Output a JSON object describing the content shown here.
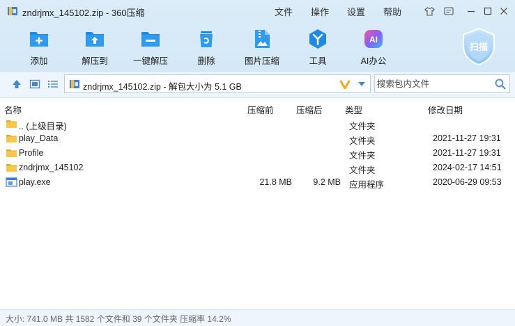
{
  "window": {
    "title": "zndrjmx_145102.zip - 360压缩"
  },
  "menu": [
    "文件",
    "操作",
    "设置",
    "帮助"
  ],
  "toolbar": [
    {
      "label": "添加",
      "icon": "add-icon"
    },
    {
      "label": "解压到",
      "icon": "extract-to-icon"
    },
    {
      "label": "一键解压",
      "icon": "one-click-extract-icon"
    },
    {
      "label": "删除",
      "icon": "delete-icon"
    },
    {
      "label": "图片压缩",
      "icon": "image-compress-icon"
    },
    {
      "label": "工具",
      "icon": "tools-icon"
    },
    {
      "label": "AI办公",
      "icon": "ai-office-icon"
    }
  ],
  "scan": {
    "label": "扫描"
  },
  "address": {
    "path": "zndrjmx_145102.zip - 解包大小为 5.1 GB"
  },
  "search": {
    "placeholder": "搜索包内文件"
  },
  "columns": {
    "name": "名称",
    "before": "压缩前",
    "after": "压缩后",
    "type": "类型",
    "date": "修改日期"
  },
  "files": [
    {
      "name": ".. (上级目录)",
      "before": "",
      "after": "",
      "type": "文件夹",
      "date": "",
      "icon": "folder-icon"
    },
    {
      "name": "play_Data",
      "before": "",
      "after": "",
      "type": "文件夹",
      "date": "2021-11-27 19:31",
      "icon": "folder-icon"
    },
    {
      "name": "Profile",
      "before": "",
      "after": "",
      "type": "文件夹",
      "date": "2021-11-27 19:31",
      "icon": "folder-icon"
    },
    {
      "name": "zndrjmx_145102",
      "before": "",
      "after": "",
      "type": "文件夹",
      "date": "2024-02-17 14:51",
      "icon": "folder-icon"
    },
    {
      "name": "play.exe",
      "before": "21.8 MB",
      "after": "9.2 MB",
      "type": "应用程序",
      "date": "2020-06-29 09:53",
      "icon": "exe-icon"
    }
  ],
  "status": {
    "text": "大小: 741.0 MB 共 1582 个文件和 39 个文件夹 压缩率 14.2%"
  },
  "colors": {
    "accent": "#1e8ae6",
    "toolbar_bg": "#d6e9f8",
    "folder": "#f5c342"
  }
}
